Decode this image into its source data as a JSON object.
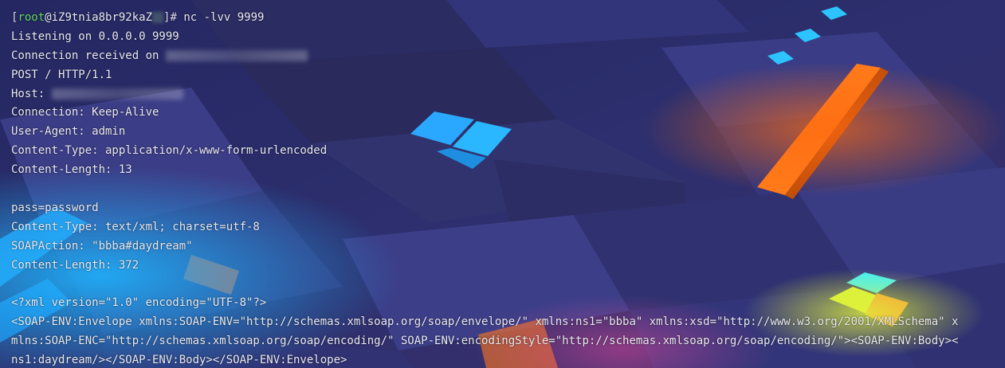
{
  "prompt": {
    "open_bracket": "[",
    "user": "root",
    "at": "@",
    "host": "iZ9tnia8br92kaZ",
    "close": "]# ",
    "command": "nc -lvv 9999"
  },
  "output": {
    "listening": "Listening on 0.0.0.0 9999",
    "connection": "Connection received on ",
    "request_line": "POST / HTTP/1.1",
    "host": "Host: ",
    "keep_alive": "Connection: Keep-Alive",
    "user_agent": "User-Agent: admin",
    "content_type_form": "Content-Type: application/x-www-form-urlencoded",
    "content_length_13": "Content-Length: 13",
    "blank1": "",
    "body": "pass=password",
    "content_type_xml": "Content-Type: text/xml; charset=utf-8",
    "soap_action": "SOAPAction: \"bbba#daydream\"",
    "content_length_372": "Content-Length: 372",
    "blank2": "",
    "xml_decl": "<?xml version=\"1.0\" encoding=\"UTF-8\"?>",
    "xml_line1": "<SOAP-ENV:Envelope xmlns:SOAP-ENV=\"http://schemas.xmlsoap.org/soap/envelope/\" xmlns:ns1=\"bbba\" xmlns:xsd=\"http://www.w3.org/2001/XMLSchema\" x",
    "xml_line2": "mlns:SOAP-ENC=\"http://schemas.xmlsoap.org/soap/encoding/\" SOAP-ENV:encodingStyle=\"http://schemas.xmlsoap.org/soap/encoding/\"><SOAP-ENV:Body><",
    "xml_line3": "ns1:daydream/></SOAP-ENV:Body></SOAP-ENV:Envelope>"
  },
  "colors": {
    "prompt_user": "#5fd75f",
    "text": "#e8e8f0",
    "accent_orange": "#ff7a1a",
    "accent_blue": "#2ab7ff"
  }
}
